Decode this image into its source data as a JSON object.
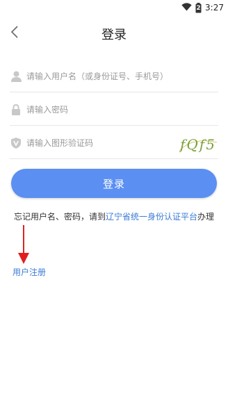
{
  "status_bar": {
    "time": "3:27",
    "battery_level": "2"
  },
  "nav": {
    "title": "登录",
    "back_icon": "chevron-left-icon"
  },
  "form": {
    "username_placeholder": "请输入用户名（或身份证号、手机号）",
    "password_placeholder": "请输入密码",
    "captcha_placeholder": "请输入图形验证码",
    "captcha_text": "fQf5"
  },
  "login_button_label": "登录",
  "hint": {
    "prefix": "忘记用户名、密码，请到",
    "link": "辽宁省统一身份认证平台",
    "suffix": "办理"
  },
  "register_link": "用户注册",
  "colors": {
    "primary": "#5b8ff2",
    "link": "#3a7bd5",
    "annotation": "#e02020"
  }
}
